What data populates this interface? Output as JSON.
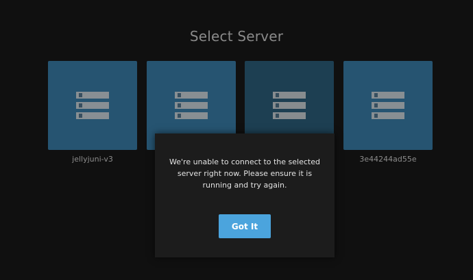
{
  "page": {
    "title": "Select Server"
  },
  "servers": [
    {
      "label": "jellyjuni-v3",
      "icon": "server-icon",
      "highlighted": true
    },
    {
      "label": "",
      "icon": "server-icon",
      "highlighted": true
    },
    {
      "label": "",
      "icon": "server-icon",
      "highlighted": false
    },
    {
      "label": "3e44244ad55e",
      "icon": "server-icon",
      "highlighted": true
    }
  ],
  "dialog": {
    "message": "We're unable to connect to the selected server right now. Please ensure it is running and try again.",
    "button_label": "Got It"
  },
  "colors": {
    "background": "#101010",
    "tile": "#265471",
    "tile_dim": "#1d3f52",
    "accent": "#4ba4dd"
  }
}
